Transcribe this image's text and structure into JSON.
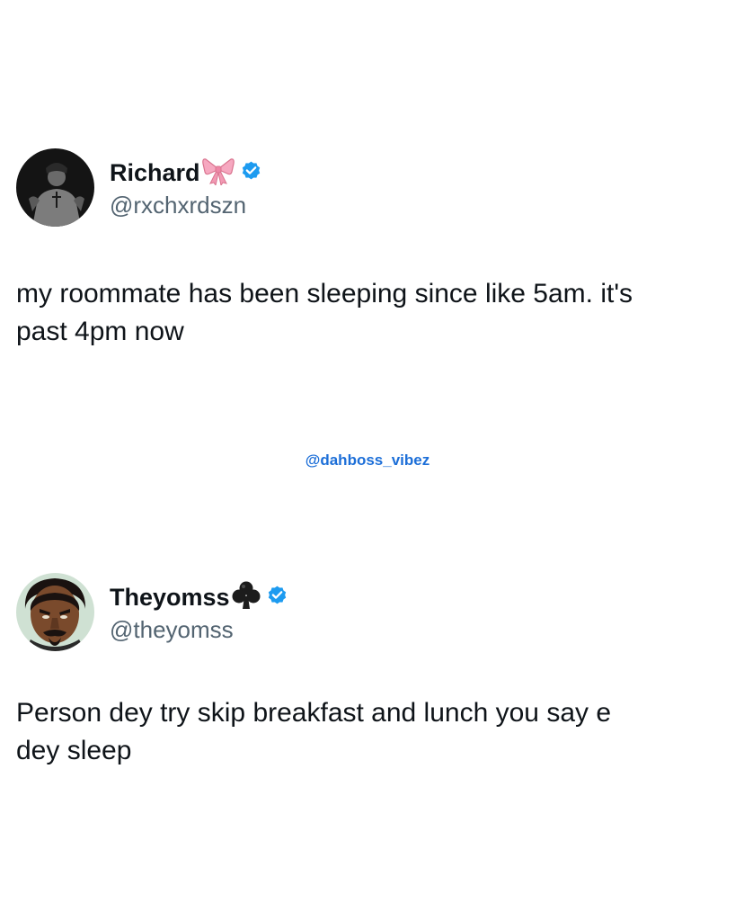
{
  "tweets": [
    {
      "display_name": "Richard",
      "name_emoji_icon": "ribbon-bow-icon",
      "verified_icon": "verified-badge-icon",
      "handle": "@rxchxrdszn",
      "text": "my roommate has been sleeping since like 5am. it's\npast 4pm now"
    },
    {
      "display_name": "Theyomss",
      "name_emoji_icon": "club-suit-icon",
      "verified_icon": "verified-badge-icon",
      "handle": "@theyomss",
      "text": "Person dey try skip breakfast and lunch you say e\ndey sleep"
    }
  ],
  "watermark": "@dahboss_vibez",
  "colors": {
    "text": "#0f1419",
    "handle": "#536471",
    "verified": "#1d9bf0",
    "watermark": "#1d6fd8",
    "background": "#ffffff"
  }
}
